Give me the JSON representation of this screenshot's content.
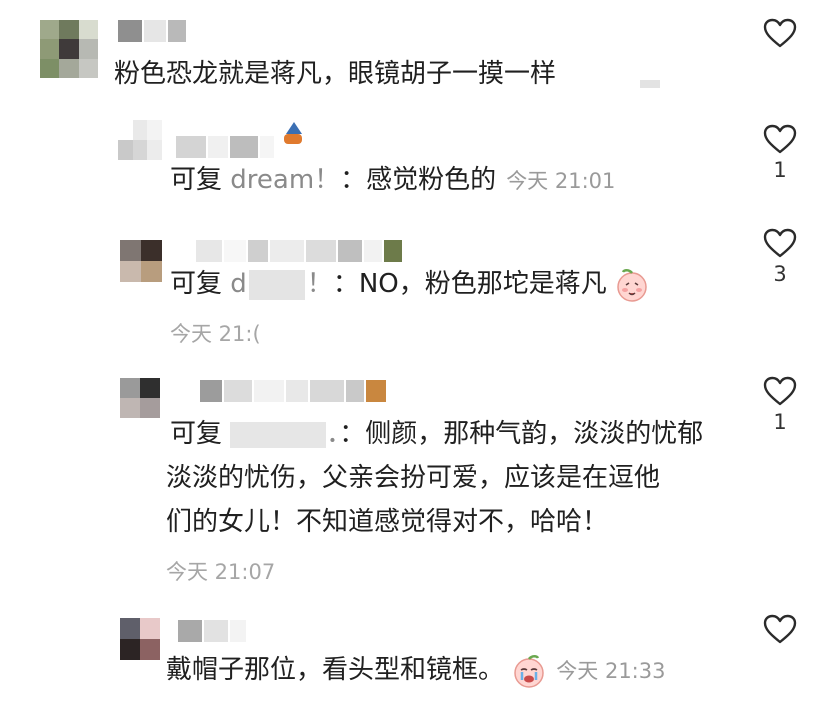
{
  "comments": [
    {
      "text": "粉色恐龙就是蒋凡，眼镜胡子一摸一样",
      "likes": ""
    },
    {
      "reply_prefix": "可复",
      "reply_to": "dream！",
      "text": "：感觉粉色的",
      "time": "今天 21:01",
      "likes": "1"
    },
    {
      "reply_prefix": "可复",
      "reply_to": "d",
      "reply_mark": "！",
      "text": "：NO，粉色那坨是蒋凡",
      "time": "今天 21:(",
      "likes": "3"
    },
    {
      "reply_prefix": "可复",
      "reply_mark": "．",
      "line1": "：侧颜，那种气韵，淡淡的忧郁",
      "line2": "淡淡的忧伤，父亲会扮可爱，应该是在逗他",
      "line3": "们的女儿！不知道感觉得对不，哈哈！",
      "time": "今天 21:07",
      "likes": "1"
    },
    {
      "text": "戴帽子那位，看头型和镜框。",
      "time": "今天 21:33",
      "likes": ""
    }
  ],
  "colors": {
    "heart": "#2b2b2b",
    "time": "#a6a6a6",
    "reply_name": "#8a8a8a"
  },
  "icons": {
    "like": "heart-outline-icon",
    "emoji1": "blushing-peach-emoji",
    "emoji2": "crying-peach-emoji"
  }
}
